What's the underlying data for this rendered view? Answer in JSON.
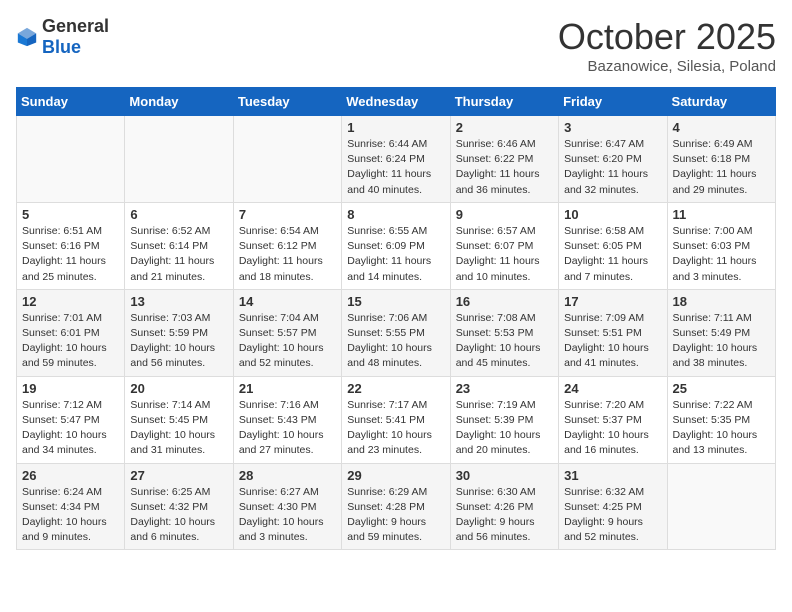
{
  "logo": {
    "general": "General",
    "blue": "Blue"
  },
  "title": "October 2025",
  "location": "Bazanowice, Silesia, Poland",
  "days_header": [
    "Sunday",
    "Monday",
    "Tuesday",
    "Wednesday",
    "Thursday",
    "Friday",
    "Saturday"
  ],
  "weeks": [
    [
      {
        "day": "",
        "info": ""
      },
      {
        "day": "",
        "info": ""
      },
      {
        "day": "",
        "info": ""
      },
      {
        "day": "1",
        "info": "Sunrise: 6:44 AM\nSunset: 6:24 PM\nDaylight: 11 hours and 40 minutes."
      },
      {
        "day": "2",
        "info": "Sunrise: 6:46 AM\nSunset: 6:22 PM\nDaylight: 11 hours and 36 minutes."
      },
      {
        "day": "3",
        "info": "Sunrise: 6:47 AM\nSunset: 6:20 PM\nDaylight: 11 hours and 32 minutes."
      },
      {
        "day": "4",
        "info": "Sunrise: 6:49 AM\nSunset: 6:18 PM\nDaylight: 11 hours and 29 minutes."
      }
    ],
    [
      {
        "day": "5",
        "info": "Sunrise: 6:51 AM\nSunset: 6:16 PM\nDaylight: 11 hours and 25 minutes."
      },
      {
        "day": "6",
        "info": "Sunrise: 6:52 AM\nSunset: 6:14 PM\nDaylight: 11 hours and 21 minutes."
      },
      {
        "day": "7",
        "info": "Sunrise: 6:54 AM\nSunset: 6:12 PM\nDaylight: 11 hours and 18 minutes."
      },
      {
        "day": "8",
        "info": "Sunrise: 6:55 AM\nSunset: 6:09 PM\nDaylight: 11 hours and 14 minutes."
      },
      {
        "day": "9",
        "info": "Sunrise: 6:57 AM\nSunset: 6:07 PM\nDaylight: 11 hours and 10 minutes."
      },
      {
        "day": "10",
        "info": "Sunrise: 6:58 AM\nSunset: 6:05 PM\nDaylight: 11 hours and 7 minutes."
      },
      {
        "day": "11",
        "info": "Sunrise: 7:00 AM\nSunset: 6:03 PM\nDaylight: 11 hours and 3 minutes."
      }
    ],
    [
      {
        "day": "12",
        "info": "Sunrise: 7:01 AM\nSunset: 6:01 PM\nDaylight: 10 hours and 59 minutes."
      },
      {
        "day": "13",
        "info": "Sunrise: 7:03 AM\nSunset: 5:59 PM\nDaylight: 10 hours and 56 minutes."
      },
      {
        "day": "14",
        "info": "Sunrise: 7:04 AM\nSunset: 5:57 PM\nDaylight: 10 hours and 52 minutes."
      },
      {
        "day": "15",
        "info": "Sunrise: 7:06 AM\nSunset: 5:55 PM\nDaylight: 10 hours and 48 minutes."
      },
      {
        "day": "16",
        "info": "Sunrise: 7:08 AM\nSunset: 5:53 PM\nDaylight: 10 hours and 45 minutes."
      },
      {
        "day": "17",
        "info": "Sunrise: 7:09 AM\nSunset: 5:51 PM\nDaylight: 10 hours and 41 minutes."
      },
      {
        "day": "18",
        "info": "Sunrise: 7:11 AM\nSunset: 5:49 PM\nDaylight: 10 hours and 38 minutes."
      }
    ],
    [
      {
        "day": "19",
        "info": "Sunrise: 7:12 AM\nSunset: 5:47 PM\nDaylight: 10 hours and 34 minutes."
      },
      {
        "day": "20",
        "info": "Sunrise: 7:14 AM\nSunset: 5:45 PM\nDaylight: 10 hours and 31 minutes."
      },
      {
        "day": "21",
        "info": "Sunrise: 7:16 AM\nSunset: 5:43 PM\nDaylight: 10 hours and 27 minutes."
      },
      {
        "day": "22",
        "info": "Sunrise: 7:17 AM\nSunset: 5:41 PM\nDaylight: 10 hours and 23 minutes."
      },
      {
        "day": "23",
        "info": "Sunrise: 7:19 AM\nSunset: 5:39 PM\nDaylight: 10 hours and 20 minutes."
      },
      {
        "day": "24",
        "info": "Sunrise: 7:20 AM\nSunset: 5:37 PM\nDaylight: 10 hours and 16 minutes."
      },
      {
        "day": "25",
        "info": "Sunrise: 7:22 AM\nSunset: 5:35 PM\nDaylight: 10 hours and 13 minutes."
      }
    ],
    [
      {
        "day": "26",
        "info": "Sunrise: 6:24 AM\nSunset: 4:34 PM\nDaylight: 10 hours and 9 minutes."
      },
      {
        "day": "27",
        "info": "Sunrise: 6:25 AM\nSunset: 4:32 PM\nDaylight: 10 hours and 6 minutes."
      },
      {
        "day": "28",
        "info": "Sunrise: 6:27 AM\nSunset: 4:30 PM\nDaylight: 10 hours and 3 minutes."
      },
      {
        "day": "29",
        "info": "Sunrise: 6:29 AM\nSunset: 4:28 PM\nDaylight: 9 hours and 59 minutes."
      },
      {
        "day": "30",
        "info": "Sunrise: 6:30 AM\nSunset: 4:26 PM\nDaylight: 9 hours and 56 minutes."
      },
      {
        "day": "31",
        "info": "Sunrise: 6:32 AM\nSunset: 4:25 PM\nDaylight: 9 hours and 52 minutes."
      },
      {
        "day": "",
        "info": ""
      }
    ]
  ]
}
